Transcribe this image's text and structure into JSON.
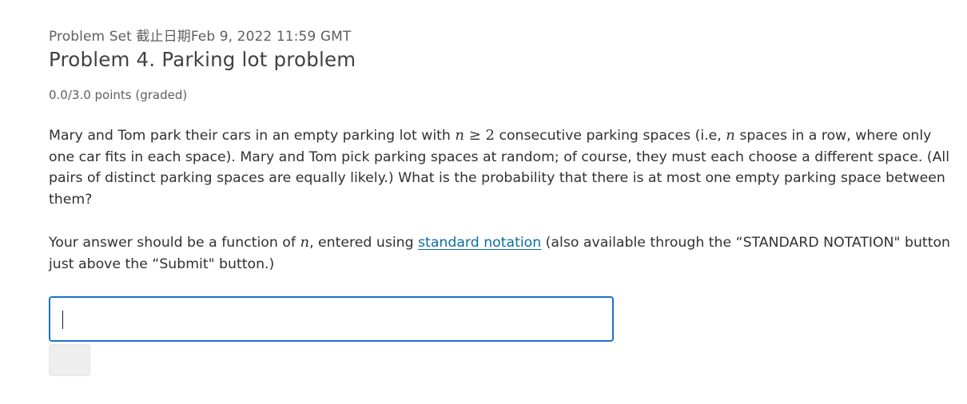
{
  "header": {
    "subtitle": "Problem Set 截止日期Feb 9, 2022 11:59 GMT",
    "title": "Problem 4. Parking lot problem",
    "points": "0.0/3.0 points (graded)"
  },
  "problem": {
    "p1_a": "Mary and Tom park their cars in an empty parking lot with ",
    "p1_math1": "n",
    "p1_math2": " ≥ 2",
    "p1_b": " consecutive parking spaces (i.e, ",
    "p1_math3": "n",
    "p1_c": " spaces in a row, where only one car fits in each space). Mary and Tom pick parking spaces at random; of course, they must each choose a different space. (All pairs of distinct parking spaces are equally likely.) What is the probability that there is at most one empty parking space between them?",
    "p2_a": "Your answer should be a function of ",
    "p2_math": "n",
    "p2_b": ", entered using ",
    "p2_link": "standard notation",
    "p2_c": " (also available through the “STANDARD NOTATION\" button just above the “Submit\" button.)"
  },
  "answer": {
    "value": "",
    "placeholder": ""
  },
  "submit": {
    "label": ""
  }
}
